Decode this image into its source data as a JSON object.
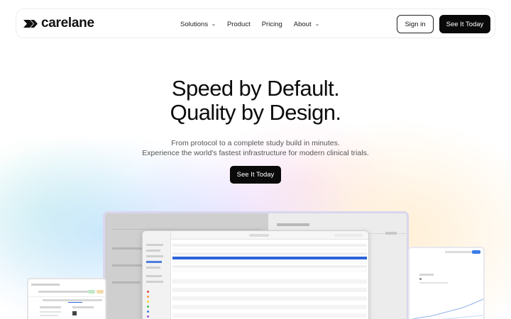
{
  "brand": {
    "name": "carelane",
    "logo_icon": "double-chevron-logo"
  },
  "nav": {
    "items": [
      {
        "label": "Solutions",
        "has_dropdown": true
      },
      {
        "label": "Product",
        "has_dropdown": false
      },
      {
        "label": "Pricing",
        "has_dropdown": false
      },
      {
        "label": "About",
        "has_dropdown": true
      }
    ],
    "sign_in_label": "Sign in",
    "cta_label": "See It Today"
  },
  "hero": {
    "headline_line1": "Speed by Default.",
    "headline_line2": "Quality by Design.",
    "subtitle_line1": "From protocol to a complete study build in minutes.",
    "subtitle_line2": "Experience the world's fastest infrastructure for modern clinical trials.",
    "cta_label": "See It Today"
  },
  "colors": {
    "cta_background": "#0a0a0a",
    "finder_selection": "#2b63d9"
  }
}
